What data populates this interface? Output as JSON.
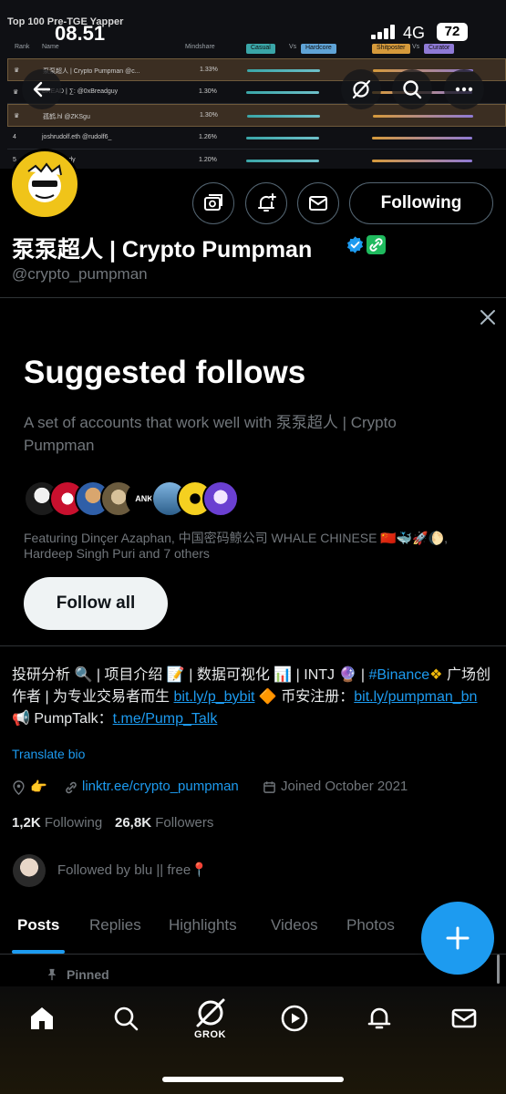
{
  "banner": {
    "title": "Top 100 Pre-TGE Yapper",
    "columns": {
      "rank": "Rank",
      "name": "Name",
      "mindshare": "Mindshare"
    },
    "chips": [
      {
        "label": "Casual",
        "color": "#3aa6a8"
      },
      {
        "label": "Vs",
        "color": ""
      },
      {
        "label": "Hardcore",
        "color": "#5fa3d6"
      },
      {
        "label": "Shitposter",
        "color": "#d69a3b"
      },
      {
        "label": "Vs",
        "color": ""
      },
      {
        "label": "Curator",
        "color": "#8f7ad6"
      }
    ],
    "rows": [
      {
        "rank": "",
        "name": "泵泵超人 | Crypto Pumpman @c...",
        "pct": "1.33%"
      },
      {
        "rank": "",
        "name": "BREAD | ∑: @0xBreadguy",
        "pct": "1.30%"
      },
      {
        "rank": "",
        "name": "孤鹤.hl @ZKSgu",
        "pct": "1.30%"
      },
      {
        "rank": "4",
        "name": "joshrudolf.eth @rudolf6_",
        "pct": "1.26%"
      },
      {
        "rank": "5",
        "name": "@yyyeandy",
        "pct": "1.20%"
      }
    ]
  },
  "status_bar": {
    "time": "08.51",
    "network": "4G",
    "battery": "72"
  },
  "profile": {
    "display_name": "泵泵超人 | Crypto Pumpman",
    "handle": "@crypto_pumpman",
    "following_label": "Following"
  },
  "suggested": {
    "title": "Suggested follows",
    "description": "A set of accounts that work well with 泵泵超人 | Crypto Pumpman",
    "featuring": "Featuring Dinçer Azaphan, 中国密码鲸公司 WHALE CHINESE 🇨🇳🐳🚀🌔, Hardeep Singh Puri and 7 others",
    "follow_all_label": "Follow all"
  },
  "bio": {
    "part1": "投研分析 🔍 | 项目介绍 📝 | 数据可视化 📊 | INTJ 🔮 | ",
    "hashtag": "#Binance",
    "part2": " 广场创作者 | 为专业交易者而生 ",
    "link1": "bit.ly/p_bybit",
    "part3": " 🔶 币安注册：",
    "link2": "bit.ly/pumpman_bn",
    "part4": " 📢 PumpTalk：",
    "link3": "t.me/Pump_Talk"
  },
  "translate_label": "Translate bio",
  "meta": {
    "location_emoji": "👉",
    "website": "linktr.ee/crypto_pumpman",
    "joined": "Joined October 2021"
  },
  "stats": {
    "following_count": "1,2K",
    "following_label": "Following",
    "followers_count": "26,8K",
    "followers_label": "Followers"
  },
  "followed_by": "Followed by blu || free📍",
  "tabs": [
    "Posts",
    "Replies",
    "Highlights",
    "Videos",
    "Photos"
  ],
  "pinned_label": "Pinned",
  "nav": {
    "grok_label": "GROK"
  },
  "colors": {
    "accent": "#1d9bf0",
    "background": "#000000",
    "muted": "#71767b"
  }
}
